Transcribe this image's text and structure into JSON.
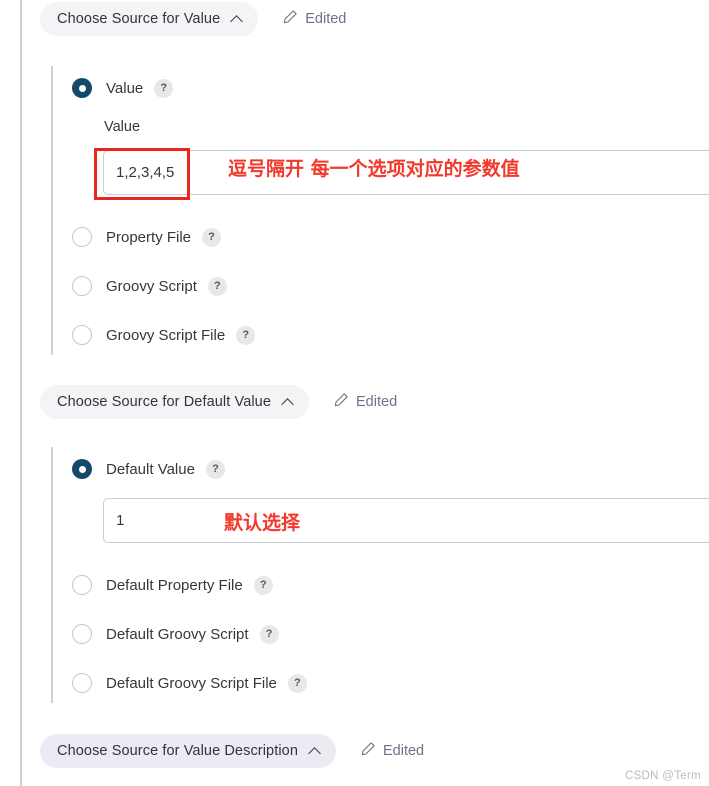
{
  "panel": {
    "watermark": "CSDN @Term"
  },
  "sections": [
    {
      "title": "Choose Source for Value",
      "edited_label": "Edited",
      "chevron_icon": "chevron-up-icon",
      "pencil_icon": "pencil-icon",
      "options": [
        {
          "label": "Value",
          "selected": true,
          "help": "?"
        },
        {
          "label": "Property File",
          "selected": false,
          "help": "?"
        },
        {
          "label": "Groovy Script",
          "selected": false,
          "help": "?"
        },
        {
          "label": "Groovy Script File",
          "selected": false,
          "help": "?"
        }
      ],
      "field": {
        "label": "Value",
        "value": "1,2,3,4,5",
        "placeholder": ""
      }
    },
    {
      "title": "Choose Source for Default Value",
      "edited_label": "Edited",
      "chevron_icon": "chevron-up-icon",
      "pencil_icon": "pencil-icon",
      "options": [
        {
          "label": "Default Value",
          "selected": true,
          "help": "?"
        },
        {
          "label": "Default Property File",
          "selected": false,
          "help": "?"
        },
        {
          "label": "Default Groovy Script",
          "selected": false,
          "help": "?"
        },
        {
          "label": "Default Groovy Script File",
          "selected": false,
          "help": "?"
        }
      ],
      "field": {
        "label": "",
        "value": "1",
        "placeholder": ""
      }
    },
    {
      "title": "Choose Source for Value Description",
      "edited_label": "Edited",
      "chevron_icon": "chevron-up-icon",
      "pencil_icon": "pencil-icon",
      "options": [],
      "field": null
    }
  ],
  "annotations": [
    {
      "text": "逗号隔开 每一个选项对应的参数值",
      "color": "#f2392c",
      "size": "19px"
    },
    {
      "text": "默认选择",
      "color": "#f2392c",
      "size": "19px"
    }
  ]
}
